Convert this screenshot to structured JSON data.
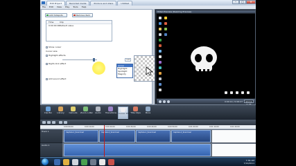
{
  "window": {
    "tabs": [
      "Edit Project",
      "Recorded media",
      "Produce and share",
      "Untitled"
    ],
    "min": "–",
    "max": "□",
    "close": "✕"
  },
  "menu": [
    "File",
    "Edit",
    "View",
    "Play",
    "Tools",
    "Help"
  ],
  "editor": {
    "add_button": "Add hotspots",
    "remove_button": "Remove item",
    "list_headers": [
      "Time",
      "Clip"
    ],
    "list_rows": [
      [
        "0:00:00:00",
        "Default value"
      ]
    ],
    "opt_show_cursor": "Show cursor",
    "opt_cursor_size": "Cursor size",
    "opt_highlight": "Highlight effects",
    "opt_right_click": "Right-click effect",
    "opt_audio": "Add sound effect",
    "slider_value": "1.0",
    "dropdown": [
      "Arrow",
      "Highlight",
      "Spotlight",
      "Magnify"
    ]
  },
  "preview": {
    "title": "Video Preview (Resizing Preview)",
    "time": "0:00:14 / 0:06:27",
    "size": "Shrink to fit"
  },
  "tasks": [
    {
      "label": "Clip Bin",
      "color": "#6aa0d8"
    },
    {
      "label": "Library",
      "color": "#d8a45a"
    },
    {
      "label": "Callouts",
      "color": "#e0d070"
    },
    {
      "label": "Zoom-n-Pan",
      "color": "#7fc07a"
    },
    {
      "label": "Audio",
      "color": "#b2b8c2"
    },
    {
      "label": "Transitions",
      "color": "#9c84c8"
    },
    {
      "label": "Cursor Effects",
      "color": "#f0eef0"
    },
    {
      "label": "Title Clips",
      "color": "#d87a62"
    },
    {
      "label": "More",
      "color": "#8fa8c4"
    }
  ],
  "timeline": {
    "ticks": [
      "0:00:00;00",
      "0:00:10;00",
      "0:00:20;00",
      "0:00:30;00",
      "0:00:40;00",
      "0:00:50;00",
      "0:01:00;00",
      "0:01:10;00",
      "0:01:20;00"
    ],
    "track1": "Track 1",
    "track2": "Audio 1",
    "clips": [
      "Capture-1_Sound.avi",
      "Capture-1_Sound.avi",
      "Capture-1_Sound.avi",
      "Capture-1_Sound.avi"
    ]
  },
  "tray": {
    "time": "7:36 AM",
    "date": "7/14/2011"
  }
}
